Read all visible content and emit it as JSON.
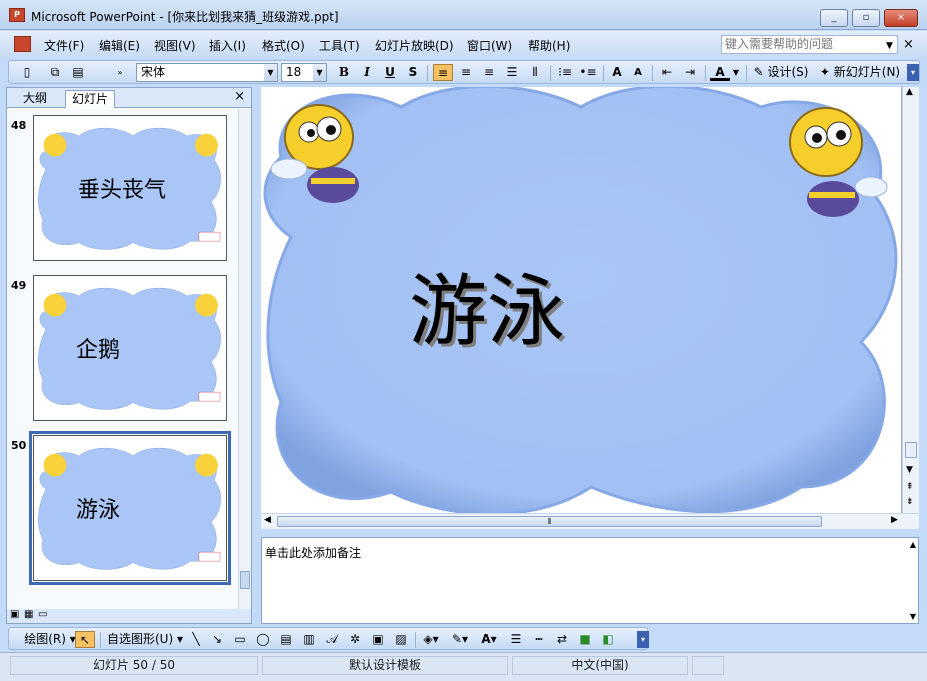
{
  "window": {
    "title": "Microsoft PowerPoint - [你来比划我来猜_班级游戏.ppt]",
    "app_icon": "P",
    "controls": [
      "_",
      "▫",
      "×"
    ]
  },
  "menubar": {
    "items": [
      "文件(F)",
      "编辑(E)",
      "视图(V)",
      "插入(I)",
      "格式(O)",
      "工具(T)",
      "幻灯片放映(D)",
      "窗口(W)",
      "帮助(H)"
    ],
    "help_placeholder": "键入需要帮助的问题",
    "close": "×"
  },
  "toolbar": {
    "font_name": "宋体",
    "font_size": "18",
    "bold": "B",
    "italic": "I",
    "underline": "U",
    "shadow": "S",
    "grow": "A",
    "shrink": "A",
    "font_color": "A",
    "design_label": "设计(S)",
    "new_slide_label": "新幻灯片(N)"
  },
  "left_pane": {
    "tab_outline": "大纲",
    "tab_slides": "幻灯片",
    "close": "×",
    "thumbnails": [
      {
        "number": "48",
        "text": "垂头丧气",
        "selected": false
      },
      {
        "number": "49",
        "text": "企鹅",
        "selected": false
      },
      {
        "number": "50",
        "text": "游泳",
        "selected": true
      }
    ]
  },
  "slide": {
    "word": "游泳",
    "cloud_color": "#a9c6f6"
  },
  "notes": {
    "placeholder": "单击此处添加备注"
  },
  "drawing_toolbar": {
    "draw_label": "绘图(R)",
    "autoshapes_label": "自选图形(U)"
  },
  "status_bar": {
    "slide_info": "幻灯片 50 / 50",
    "template": "默认设计模板",
    "language": "中文(中国)"
  }
}
